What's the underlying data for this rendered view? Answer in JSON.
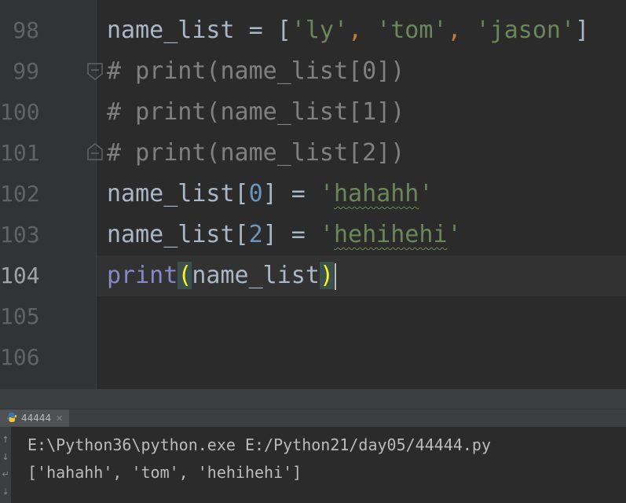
{
  "editor": {
    "line_numbers": [
      "98",
      "99",
      "100",
      "101",
      "102",
      "103",
      "104",
      "105",
      "106"
    ],
    "lines": [
      {
        "tokens": [
          {
            "t": "name_list ",
            "c": "id"
          },
          {
            "t": "= ",
            "c": "id"
          },
          {
            "t": "[",
            "c": "id"
          },
          {
            "t": "'ly'",
            "c": "str"
          },
          {
            "t": ", ",
            "c": "punc"
          },
          {
            "t": "'tom'",
            "c": "str"
          },
          {
            "t": ", ",
            "c": "punc"
          },
          {
            "t": "'jason'",
            "c": "str"
          },
          {
            "t": "]",
            "c": "id"
          }
        ]
      },
      {
        "tokens": [
          {
            "t": "# print(name_list[0])",
            "c": "com"
          }
        ]
      },
      {
        "tokens": [
          {
            "t": "# print(name_list[1])",
            "c": "com"
          }
        ]
      },
      {
        "tokens": [
          {
            "t": "# print(name_list[2])",
            "c": "com"
          }
        ]
      },
      {
        "tokens": [
          {
            "t": "name_list[",
            "c": "id"
          },
          {
            "t": "0",
            "c": "num"
          },
          {
            "t": "] = ",
            "c": "id"
          },
          {
            "t": "'",
            "c": "str"
          },
          {
            "t": "hahahh",
            "c": "str-sq"
          },
          {
            "t": "'",
            "c": "str"
          }
        ]
      },
      {
        "tokens": [
          {
            "t": "name_list[",
            "c": "id"
          },
          {
            "t": "2",
            "c": "num"
          },
          {
            "t": "] = ",
            "c": "id"
          },
          {
            "t": "'",
            "c": "str"
          },
          {
            "t": "hehihehi",
            "c": "str-sq"
          },
          {
            "t": "'",
            "c": "str"
          }
        ]
      },
      {
        "tokens": [
          {
            "t": "print",
            "c": "fn"
          },
          {
            "t": "(",
            "c": "paren"
          },
          {
            "t": "name_list",
            "c": "id"
          },
          {
            "t": ")",
            "c": "paren"
          },
          {
            "t": "",
            "c": "caret"
          }
        ]
      },
      {
        "tokens": []
      },
      {
        "tokens": []
      }
    ],
    "current_line": "104"
  },
  "run_panel": {
    "tab_label": "44444",
    "tab_icon": "python-icon",
    "close_icon": "close-icon",
    "console": [
      "E:\\Python36\\python.exe E:/Python21/day05/44444.py",
      "['hahahh', 'tom', 'hehihehi']"
    ]
  },
  "colors": {
    "background": "#2b2b2b",
    "string": "#6a8759",
    "keyword_punct": "#cc7832",
    "comment": "#808080",
    "number": "#6897bb",
    "builtin": "#8888c6",
    "paren_match": "#ffef28"
  }
}
